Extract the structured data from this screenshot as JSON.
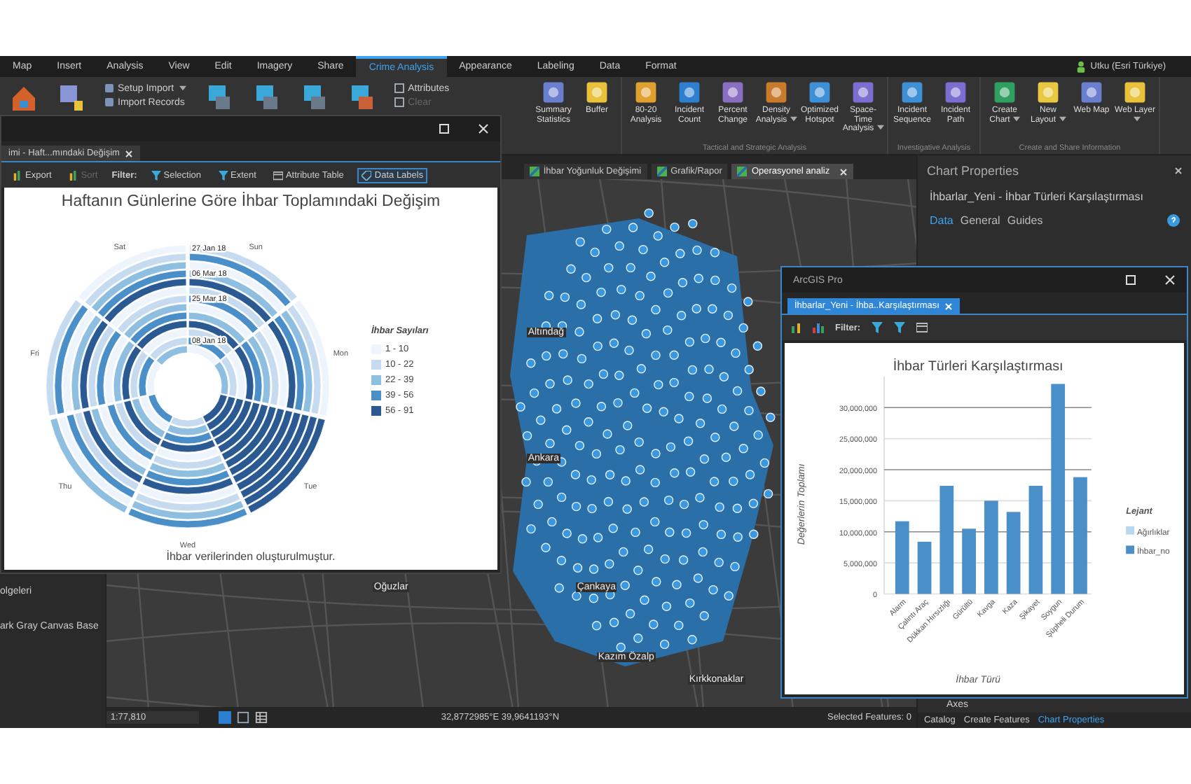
{
  "menu_tabs": [
    {
      "label": "Map",
      "selected": false
    },
    {
      "label": "Insert",
      "selected": false
    },
    {
      "label": "Analysis",
      "selected": false
    },
    {
      "label": "View",
      "selected": false
    },
    {
      "label": "Edit",
      "selected": false
    },
    {
      "label": "Imagery",
      "selected": false
    },
    {
      "label": "Share",
      "selected": false
    },
    {
      "label": "Crime Analysis",
      "selected": true
    },
    {
      "label": "Appearance",
      "selected": false
    },
    {
      "label": "Labeling",
      "selected": false
    },
    {
      "label": "Data",
      "selected": false
    },
    {
      "label": "Format",
      "selected": false
    }
  ],
  "user": "Utku (Esri Türkiye)",
  "ribbon": {
    "import_buttons": [
      {
        "label": "Setup Import",
        "dropdown": true,
        "disabled": false
      },
      {
        "label": "Import Records",
        "dropdown": false,
        "disabled": false
      }
    ],
    "selection_buttons": [
      {
        "label": "Attributes",
        "dropdown": false,
        "disabled": false
      },
      {
        "label": "Clear",
        "dropdown": false,
        "disabled": true
      }
    ],
    "groups": [
      {
        "buttons": [
          {
            "label": "Summary Statistics",
            "dropdown": false
          },
          {
            "label": "Buffer",
            "dropdown": false
          }
        ]
      },
      {
        "label": "Tactical and Strategic Analysis",
        "buttons": [
          {
            "label": "80-20 Analysis",
            "dropdown": false
          },
          {
            "label": "Incident Count",
            "dropdown": false
          },
          {
            "label": "Percent Change",
            "dropdown": false
          },
          {
            "label": "Density Analysis",
            "dropdown": true
          },
          {
            "label": "Optimized Hotspot",
            "dropdown": false
          },
          {
            "label": "Space-Time Analysis",
            "dropdown": true
          }
        ]
      },
      {
        "label": "Investigative Analysis",
        "buttons": [
          {
            "label": "Incident Sequence",
            "dropdown": false
          },
          {
            "label": "Incident Path",
            "dropdown": false
          }
        ]
      },
      {
        "label": "Create and Share Information",
        "buttons": [
          {
            "label": "Create Chart",
            "dropdown": true
          },
          {
            "label": "New Layout",
            "dropdown": true
          },
          {
            "label": "Web Map",
            "dropdown": false
          },
          {
            "label": "Web Layer",
            "dropdown": true
          }
        ]
      }
    ]
  },
  "contents": [
    "olgeleri",
    "ark Gray Canvas Base"
  ],
  "map_tabs": [
    {
      "label": "İhbar Yoğunluk Değişimi",
      "selected": false
    },
    {
      "label": "Grafik/Rapor",
      "selected": false
    },
    {
      "label": "Operasyonel analiz",
      "selected": true
    }
  ],
  "map": {
    "place_labels": [
      "Altındağ",
      "Ankara",
      "Oğuzlar",
      "Çankaya",
      "Kazım Özalp",
      "Kırkkonaklar"
    ]
  },
  "status_bar": {
    "scale": "1:77,810",
    "coordinates": "32,8772985°E 39,9641193°N",
    "selected_features": "Selected Features: 0"
  },
  "chart_properties": {
    "title": "Chart Properties",
    "chart_name": "İhbarlar_Yeni - İhbar Türleri Karşılaştırması",
    "tabs": [
      {
        "label": "Data",
        "selected": true
      },
      {
        "label": "General",
        "selected": false
      },
      {
        "label": "Guides",
        "selected": false
      }
    ],
    "section": "Axes",
    "bottom_tabs": [
      {
        "label": "Catalog",
        "selected": false
      },
      {
        "label": "Create Features",
        "selected": false
      },
      {
        "label": "Chart Properties",
        "selected": true
      }
    ]
  },
  "weekly_chart_window": {
    "tab": "imi - Haft...mındaki Değişim",
    "toolbar": [
      {
        "label": "Export",
        "disabled": false
      },
      {
        "label": "Sort",
        "disabled": true
      }
    ],
    "filter_label": "Filter:",
    "filters": [
      "Selection",
      "Extent"
    ],
    "attribute_table": "Attribute Table",
    "data_labels": {
      "label": "Data Labels",
      "selected": true
    },
    "title": "Haftanın Günlerine Göre İhbar Toplamındaki Değişim",
    "days": [
      "Sun",
      "Mon",
      "Tue",
      "Wed",
      "Thu",
      "Fri",
      "Sat"
    ],
    "ring_labels": [
      "27 Jan 18",
      "06 Mar 18",
      "25 Mar 18",
      "08 Jan 18"
    ],
    "legend": {
      "title": "İhbar Sayıları",
      "items": [
        {
          "label": "1 - 10",
          "color": "#eef4fb"
        },
        {
          "label": "10 - 22",
          "color": "#c6dbef"
        },
        {
          "label": "22 - 39",
          "color": "#8fbfe0"
        },
        {
          "label": "39 - 56",
          "color": "#4a8fc8"
        },
        {
          "label": "56 - 91",
          "color": "#2b5a93"
        }
      ]
    },
    "caption": "İhbar verilerinden oluşturulmuştur."
  },
  "comparison_chart_window": {
    "title": "ArcGIS Pro",
    "tab": "İhbarlar_Yeni - İhba..Karşılaştırması",
    "filter_label": "Filter:",
    "legend_title": "Lejant",
    "chart_data": {
      "type": "bar",
      "title": "İhbar Türleri Karşılaştırması",
      "xlabel": "İhbar Türü",
      "ylabel": "Değerlerin Toplamı",
      "categories": [
        "Alarm",
        "Çalıntı Araç",
        "Dükkan Hırsızlığı",
        "Gürültü",
        "Kavga",
        "Kaza",
        "Şikayet",
        "Soygun",
        "Şüpheli Durum"
      ],
      "series": [
        {
          "name": "Ağırlıklar",
          "color": "#b9d7ee",
          "values": [
            null,
            null,
            null,
            null,
            null,
            null,
            null,
            null,
            null
          ]
        },
        {
          "name": "İhbar_no",
          "color": "#4a8fc7",
          "values": [
            11700000,
            8400000,
            17400000,
            10500000,
            15000000,
            13200000,
            17400000,
            33800000,
            18800000
          ]
        }
      ],
      "ylim": [
        0,
        35000000
      ],
      "grid": true,
      "yticks": [
        {
          "value": 0,
          "label": "0"
        },
        {
          "value": 5000000,
          "label": "5,000,000"
        },
        {
          "value": 10000000,
          "label": "10,000,000"
        },
        {
          "value": 15000000,
          "label": "15,000,000"
        },
        {
          "value": 20000000,
          "label": "20,000,000"
        },
        {
          "value": 25000000,
          "label": "25,000,000"
        },
        {
          "value": 30000000,
          "label": "30,000,000"
        }
      ]
    }
  }
}
